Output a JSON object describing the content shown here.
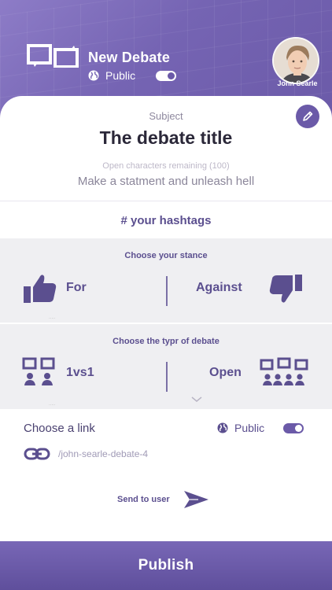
{
  "header": {
    "app_title": "New Debate",
    "visibility_label": "Public",
    "visibility_on": true,
    "user_name": "John Searle"
  },
  "subject": {
    "label": "Subject",
    "title": "The debate title",
    "chars_remaining": "Open characters remaining (100)",
    "statement": "Make a statment and unleash hell",
    "hashtags": "# your hashtags"
  },
  "stance": {
    "title": "Choose your stance",
    "for_label": "For",
    "against_label": "Against"
  },
  "debate_type": {
    "title": "Choose the typr of debate",
    "option1": "1vs1",
    "option2": "Open"
  },
  "link": {
    "title": "Choose a link",
    "visibility_label": "Public",
    "visibility_on": true,
    "slug": "/john-searle-debate-4"
  },
  "send": {
    "label": "Send to user"
  },
  "publish": {
    "label": "Publish"
  },
  "colors": {
    "accent": "#6b5aa8",
    "header_light": "#8d7cc7",
    "panel_bg": "#efeff2"
  },
  "icons": [
    "app-logo-icon",
    "globe-icon",
    "toggle-switch",
    "avatar",
    "pencil-icon",
    "thumbs-up-icon",
    "thumbs-down-icon",
    "users-two-icon",
    "users-group-icon",
    "chevron-down-icon",
    "link-icon",
    "send-icon"
  ]
}
